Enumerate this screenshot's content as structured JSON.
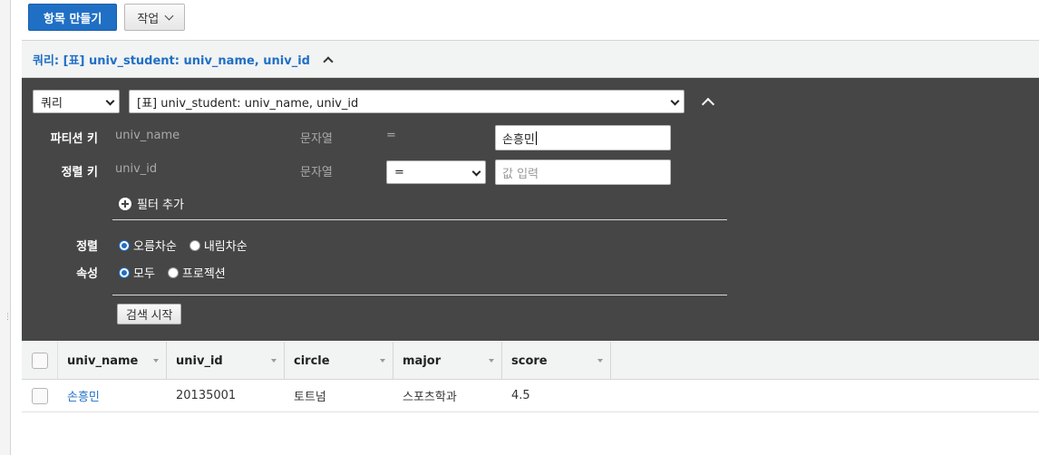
{
  "toolbar": {
    "create_item_label": "항목 만들기",
    "actions_label": "작업"
  },
  "query_header": {
    "label": "쿼리: [표] univ_student: univ_name, univ_id"
  },
  "query_panel": {
    "mode_select": "쿼리",
    "target_select": "[표] univ_student: univ_name, univ_id",
    "partition_key": {
      "label": "파티션 키",
      "attribute": "univ_name",
      "type": "문자열",
      "operator": "=",
      "value": "손흥민"
    },
    "sort_key": {
      "label": "정렬 키",
      "attribute": "univ_id",
      "type": "문자열",
      "operator": "=",
      "placeholder": "값 입력"
    },
    "add_filter_label": "필터 추가",
    "sort": {
      "label": "정렬",
      "options": [
        "오름차순",
        "내림차순"
      ],
      "selected": "오름차순"
    },
    "attributes": {
      "label": "속성",
      "options": [
        "모두",
        "프로젝션"
      ],
      "selected": "모두"
    },
    "search_button_label": "검색 시작"
  },
  "table": {
    "columns": [
      "univ_name",
      "univ_id",
      "circle",
      "major",
      "score"
    ],
    "rows": [
      [
        "손흥민",
        "20135001",
        "토트넘",
        "스포츠학과",
        "4.5"
      ]
    ]
  },
  "colors": {
    "primary": "#1f6fc5",
    "panel_bg": "#464646",
    "header_bg": "#f2f3f3"
  }
}
